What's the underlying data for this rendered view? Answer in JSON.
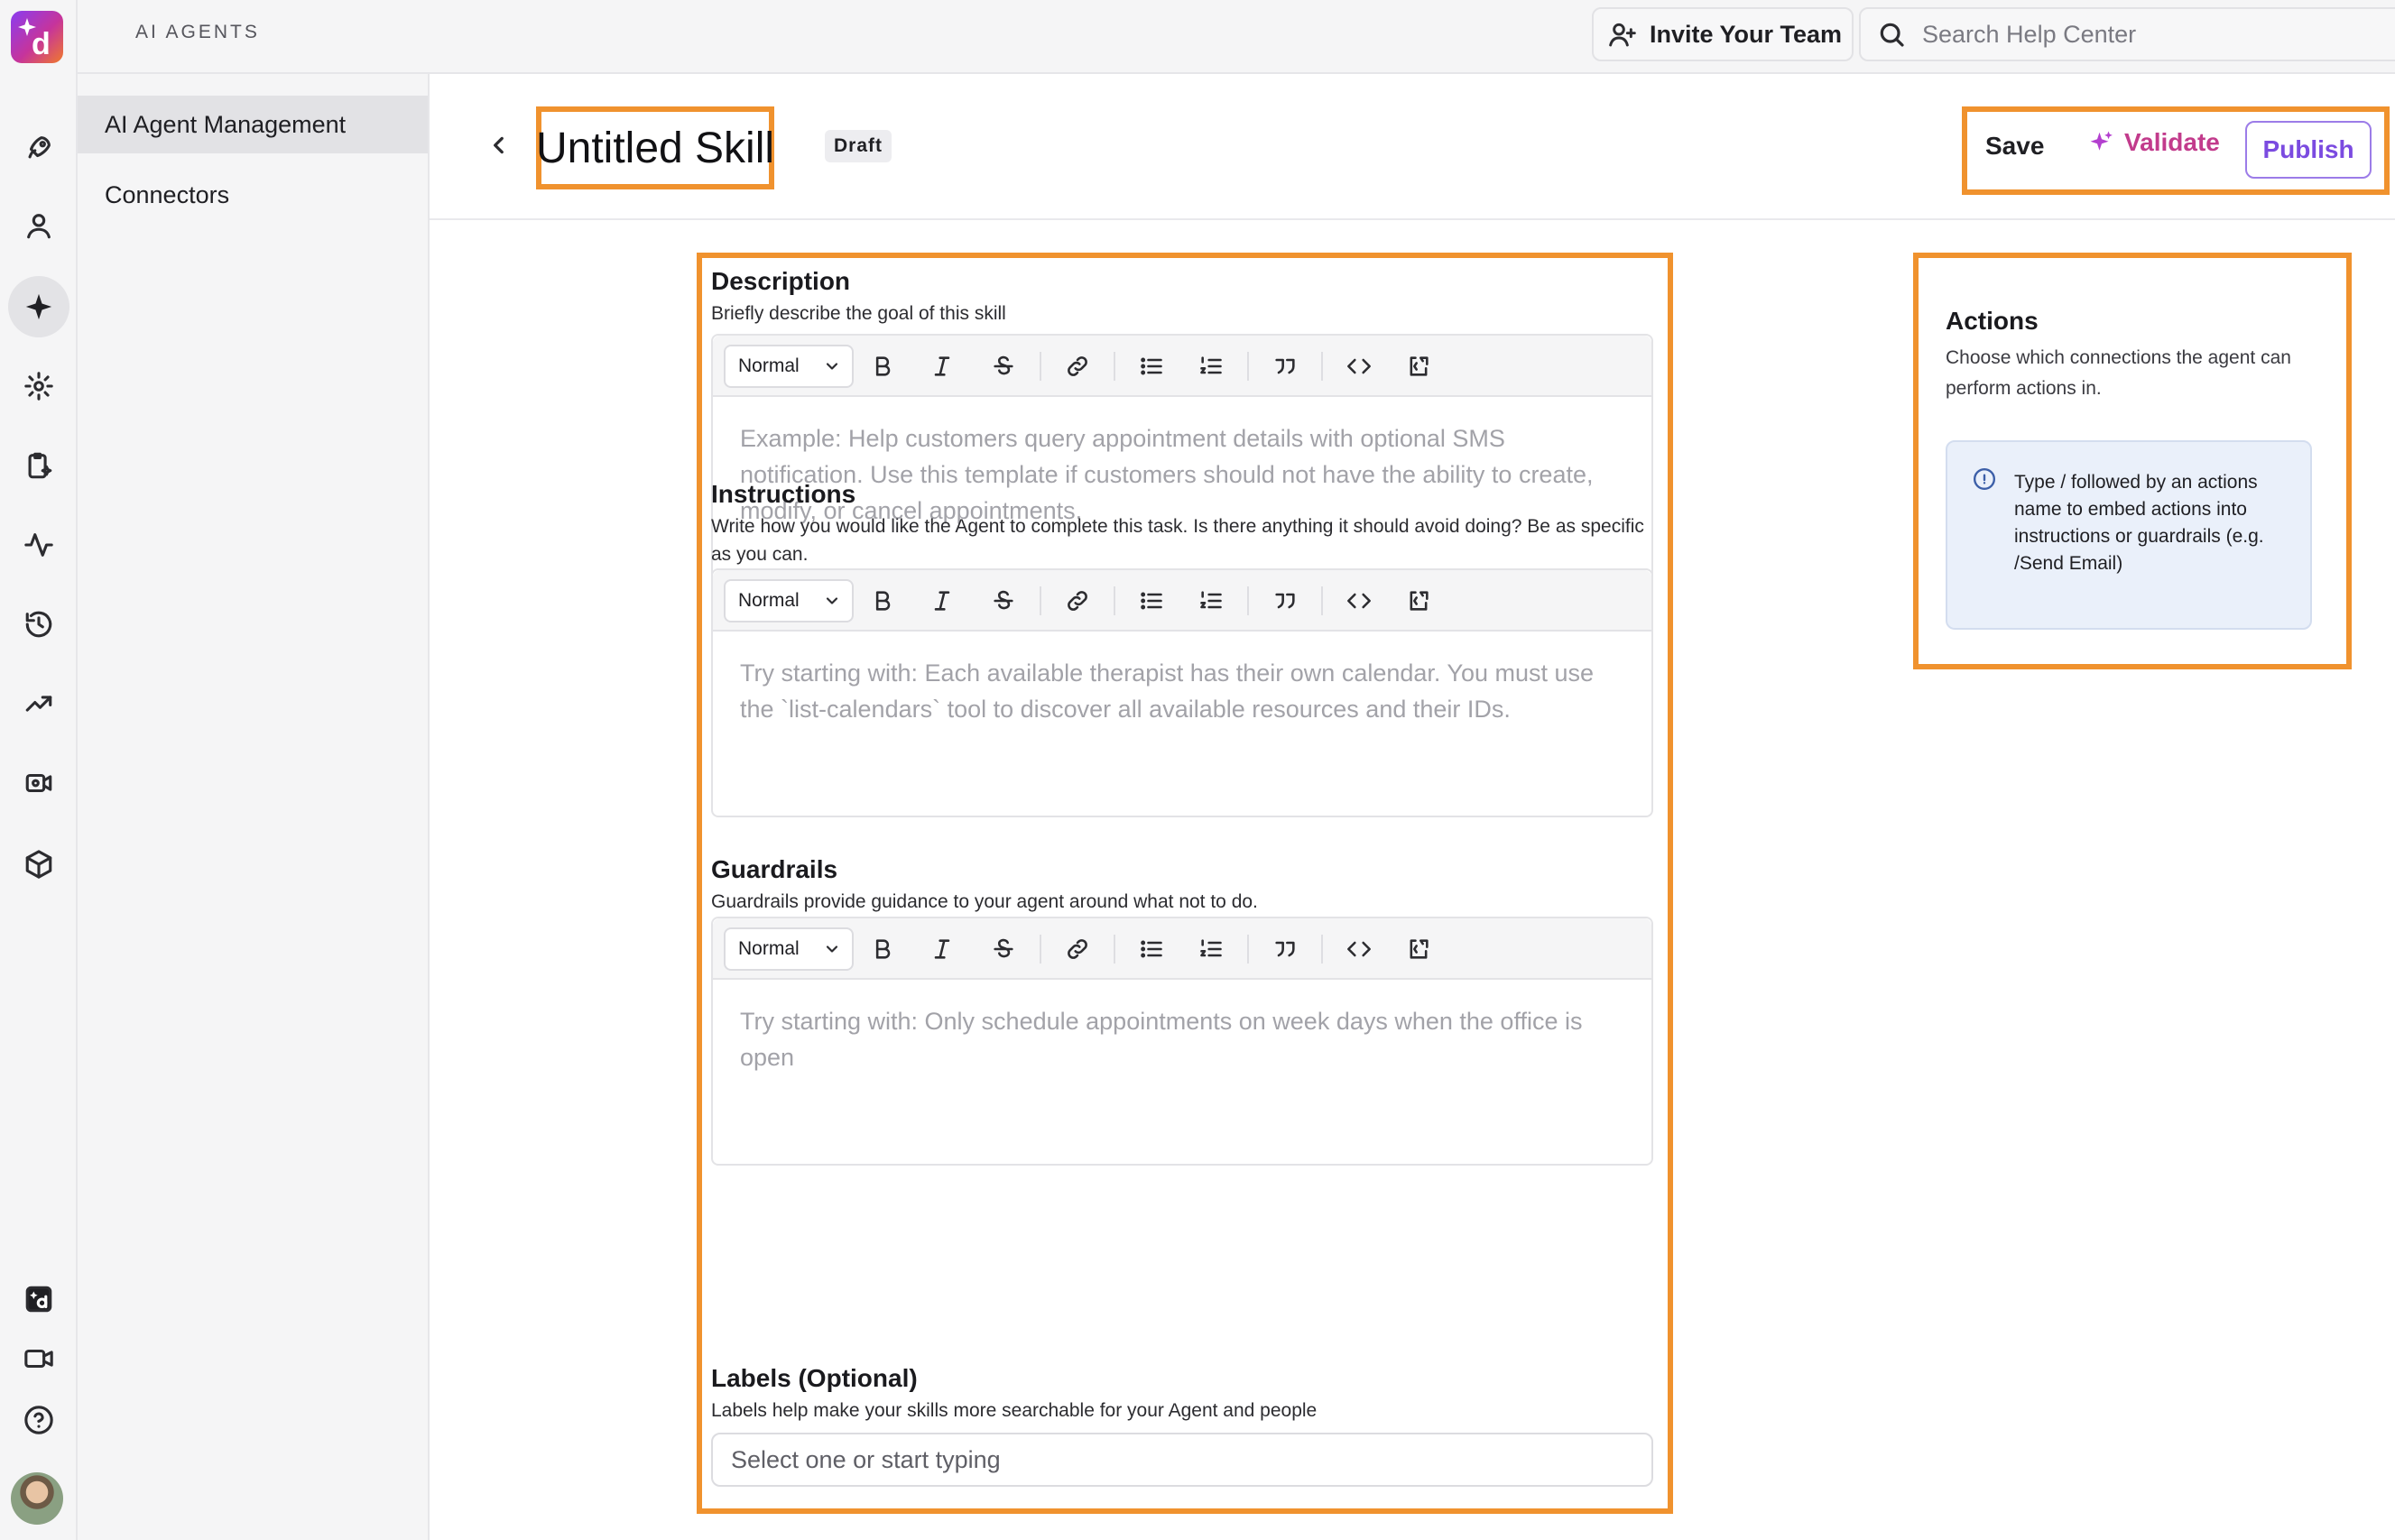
{
  "topbar": {
    "section_label": "AI AGENTS",
    "invite_label": "Invite Your Team",
    "search_placeholder": "Search Help Center"
  },
  "rail": {
    "icons": [
      "logo",
      "rocket-icon",
      "user-icon",
      "sparkle-icon",
      "gear-icon",
      "clipboard-sparkle-icon",
      "activity-icon",
      "history-icon",
      "trending-up-icon",
      "video-settings-icon",
      "cube-icon",
      "app-badge-icon",
      "video-camera-icon",
      "help-circle-icon",
      "avatar"
    ],
    "active": "sparkle-icon"
  },
  "subnav": {
    "items": [
      {
        "label": "AI Agent Management",
        "active": true
      },
      {
        "label": "Connectors",
        "active": false
      }
    ]
  },
  "header": {
    "title": "Untitled Skill",
    "badge": "Draft",
    "save_label": "Save",
    "validate_label": "Validate",
    "publish_label": "Publish"
  },
  "form": {
    "format_option": "Normal",
    "description": {
      "label": "Description",
      "help": "Briefly describe the goal of this skill",
      "placeholder": "Example: Help customers query appointment details with optional SMS notification. Use this template if customers should not have the ability to create, modify, or cancel appointments."
    },
    "instructions": {
      "label": "Instructions",
      "help": "Write how you would like the Agent to complete this task. Is there anything it should avoid doing? Be as specific as you can.",
      "placeholder": "Try starting with: Each available therapist has their own calendar. You must use the `list-calendars` tool to discover all available resources and their IDs."
    },
    "guardrails": {
      "label": "Guardrails",
      "help": "Guardrails provide guidance to your agent around what not to do.",
      "placeholder": "Try starting with: Only schedule appointments on week days when the office is open"
    },
    "labels": {
      "label": "Labels (Optional)",
      "help": "Labels help make your skills more searchable for your Agent and people",
      "placeholder": "Select one or start typing"
    }
  },
  "actions_panel": {
    "title": "Actions",
    "description": "Choose which connections the agent can perform actions in.",
    "info": "Type / followed by an actions name to embed actions into instructions or guardrails (e.g. /Send Email)"
  },
  "colors": {
    "highlight": "#f0922e",
    "publish": "#7b4be0",
    "validate": "#c23b8c",
    "info_bg": "#eaf0fa"
  }
}
